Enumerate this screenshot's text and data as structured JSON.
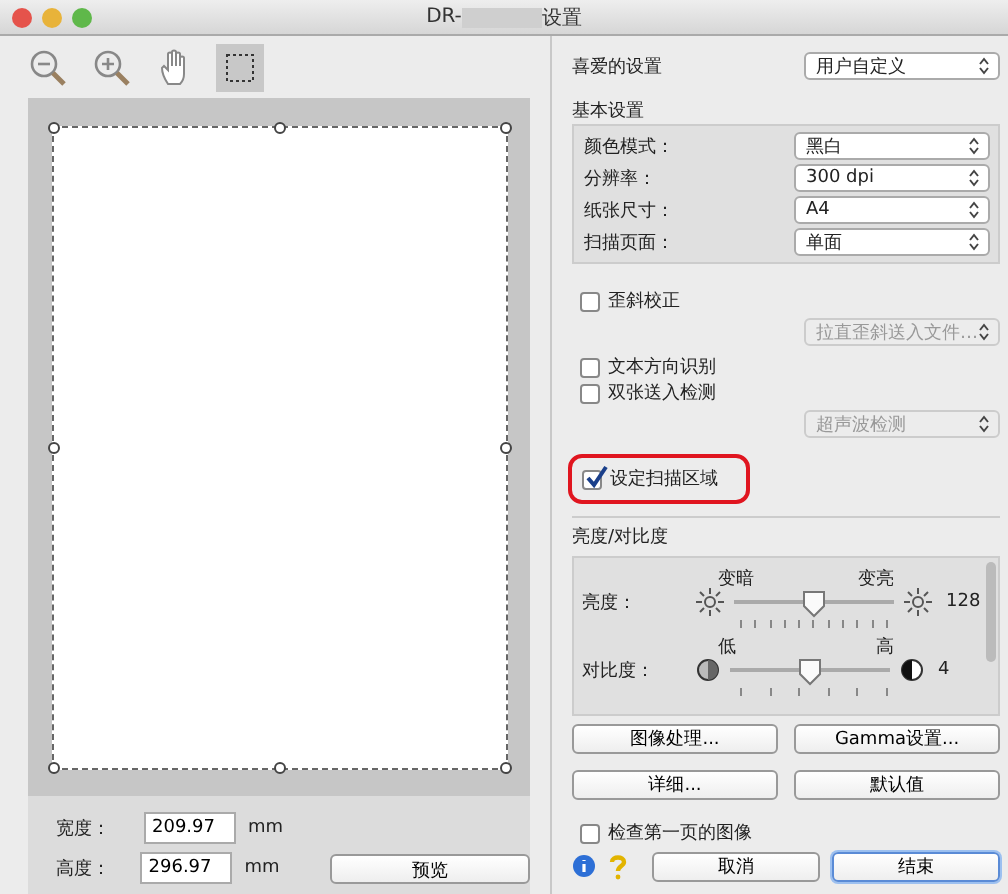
{
  "window": {
    "title_prefix": "DR-",
    "title_suffix": "设置"
  },
  "toolbar": [
    {
      "kind": "zoom-out",
      "selected": false
    },
    {
      "kind": "zoom-in",
      "selected": false
    },
    {
      "kind": "hand",
      "selected": false
    },
    {
      "kind": "select-area",
      "selected": true
    }
  ],
  "preview": {
    "width_label": "宽度：",
    "width_value": "209.97",
    "width_unit": "mm",
    "height_label": "高度：",
    "height_value": "296.97",
    "height_unit": "mm",
    "preview_button": "预览"
  },
  "favorites": {
    "label": "喜爱的设置",
    "value": "用户自定义"
  },
  "basic": {
    "title": "基本设置",
    "rows": [
      {
        "label": "颜色模式：",
        "value": "黑白"
      },
      {
        "label": "分辨率：",
        "value": "300 dpi"
      },
      {
        "label": "纸张尺寸：",
        "value": "A4"
      },
      {
        "label": "扫描页面：",
        "value": "单面"
      }
    ]
  },
  "options": [
    {
      "kind": "check",
      "label": "歪斜校正",
      "checked": false,
      "highlighted": false
    },
    {
      "kind": "select",
      "value": "拉直歪斜送入文件…",
      "disabled": true
    },
    {
      "kind": "check",
      "label": "文本方向识别",
      "checked": false,
      "highlighted": false
    },
    {
      "kind": "check",
      "label": "双张送入检测",
      "checked": false,
      "highlighted": false
    },
    {
      "kind": "select",
      "value": "超声波检测",
      "disabled": true
    },
    {
      "kind": "check",
      "label": "设定扫描区域",
      "checked": true,
      "highlighted": true
    }
  ],
  "brightness": {
    "title": "亮度/对比度",
    "sliders": [
      {
        "kind": "sun",
        "label": "亮度：",
        "low": "变暗",
        "high": "变亮",
        "level": 0.5,
        "reading": "128"
      },
      {
        "kind": "contrast",
        "label": "对比度：",
        "low": "低",
        "high": "高",
        "level": 0.5,
        "reading": "4"
      }
    ]
  },
  "buttons": [
    "图像处理...",
    "Gamma设置...",
    "详细...",
    "默认值"
  ],
  "check_first": {
    "label": "检查第一页的图像",
    "checked": false
  },
  "footer": {
    "buttons": [
      {
        "label": "取消",
        "default": false
      },
      {
        "label": "结束",
        "default": true
      }
    ]
  }
}
